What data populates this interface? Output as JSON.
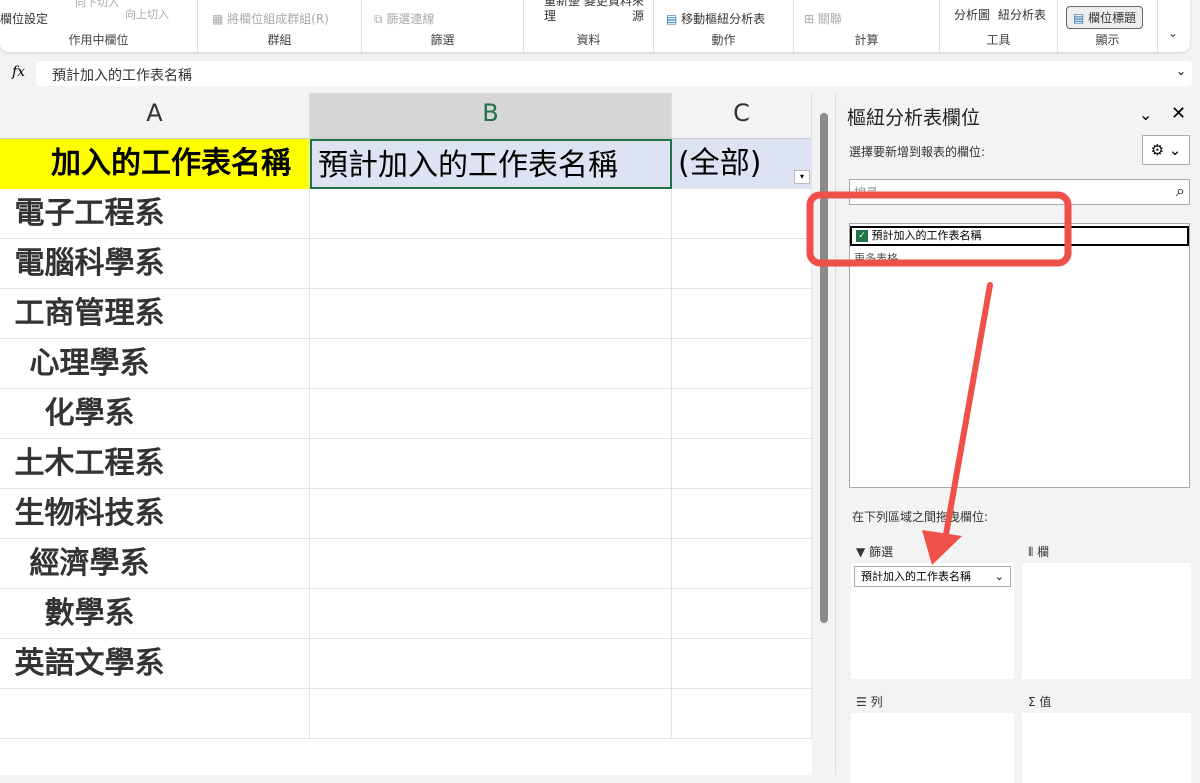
{
  "ribbon": {
    "field_settings": "欄位設定",
    "active_field_group": "作用中欄位",
    "drill_down": "向下切入",
    "drill_up": "向上切入",
    "group_field": "將欄位組成群組(R)",
    "group_group": "群組",
    "filter_connections": "篩選連線",
    "filter_group": "篩選",
    "refresh": "重新整理",
    "change_source": "變更資料來源",
    "data_group": "資料",
    "move_pivot": "移動樞紐分析表",
    "actions_group": "動作",
    "relationships": "關聯",
    "calc_group": "計算",
    "pivot_chart": "分析圖",
    "recommended_pivot": "紐分析表",
    "tools_group": "工具",
    "field_headers": "欄位標題",
    "show_group": "顯示"
  },
  "formula_bar": {
    "fx": "fx",
    "value": "預計加入的工作表名稱"
  },
  "sheet": {
    "columns": [
      "A",
      "B",
      "C"
    ],
    "rows": [
      [
        "加入的工作表名稱",
        "預計加入的工作表名稱",
        "(全部)"
      ],
      [
        "電子工程系",
        "",
        ""
      ],
      [
        "電腦科學系",
        "",
        ""
      ],
      [
        "工商管理系",
        "",
        ""
      ],
      [
        "心理學系",
        "",
        ""
      ],
      [
        "化學系",
        "",
        ""
      ],
      [
        "土木工程系",
        "",
        ""
      ],
      [
        "生物科技系",
        "",
        ""
      ],
      [
        "經濟學系",
        "",
        ""
      ],
      [
        "數學系",
        "",
        ""
      ],
      [
        "英語文學系",
        "",
        ""
      ],
      [
        "",
        "",
        ""
      ]
    ]
  },
  "pane": {
    "title": "樞紐分析表欄位",
    "subtitle": "選擇要新增到報表的欄位:",
    "search_placeholder": "搜尋",
    "fields": [
      {
        "label": "預計加入的工作表名稱",
        "checked": true
      }
    ],
    "more_tables": "更多表格...",
    "drag_hint": "在下列區域之間拖曳欄位:",
    "areas": {
      "filters": "篩選",
      "columns": "欄",
      "rows": "列",
      "values": "值"
    },
    "filter_item": "預計加入的工作表名稱"
  },
  "colors": {
    "highlight": "#ffff00",
    "callout": "#f0504a",
    "excel_green": "#217346"
  }
}
